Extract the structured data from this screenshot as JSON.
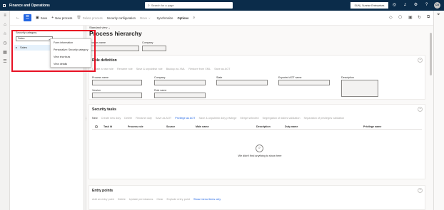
{
  "topbar": {
    "app_title": "Finance and Operations",
    "search_placeholder": "Search for a page",
    "company": "SUN | Sunrise Enterprises",
    "avatar_initials": "CG"
  },
  "actions": {
    "save": "Save",
    "new_process": "New process",
    "delete_process": "Delete process",
    "security_configuration": "Security configuration",
    "move": "Move",
    "synchronize": "Synchronize",
    "options": "Options"
  },
  "list_panel": {
    "security_category_label": "Security category",
    "security_category_value": "Sales",
    "tree_item": "Sales"
  },
  "context_menu": {
    "items": [
      "Form information",
      "Personalize: Security category",
      "View shortcuts",
      "View details"
    ]
  },
  "main": {
    "view_selector": "Standard view",
    "title": "Process hierarchy",
    "process_name_label": "Process name",
    "company_label": "Company"
  },
  "role_definition": {
    "header": "Role definition",
    "toolbar": [
      "Create a new role",
      "Rename role",
      "Save & unpublish role",
      "Backup as XML",
      "Restore from XML",
      "Save as AOT"
    ],
    "fields": {
      "process_name": "Process name",
      "company": "Company",
      "state": "State",
      "exported_aot_name": "Exported AOT name",
      "description": "Description",
      "version": "Version",
      "role_name": "Role name"
    }
  },
  "security_tasks": {
    "header": "Security tasks",
    "toolbar": [
      "New",
      "Create new duty",
      "Delete",
      "Rename duty",
      "Save as AOT",
      "Privilege as AOT",
      "Save & unpublish duty privilege",
      "Merge selected",
      "Segregation of duties validation",
      "Separation of privileges validation"
    ],
    "columns": [
      "Task Id",
      "Process role",
      "Source",
      "Main name",
      "Description",
      "Duty name",
      "Privilege name"
    ],
    "empty_message": "We didn't find anything to show here"
  },
  "entry_points": {
    "header": "Entry points",
    "toolbar": [
      "Add an entry point",
      "Delete",
      "Update permissions",
      "Clear",
      "Explode entry point",
      "Show menu items only"
    ]
  }
}
